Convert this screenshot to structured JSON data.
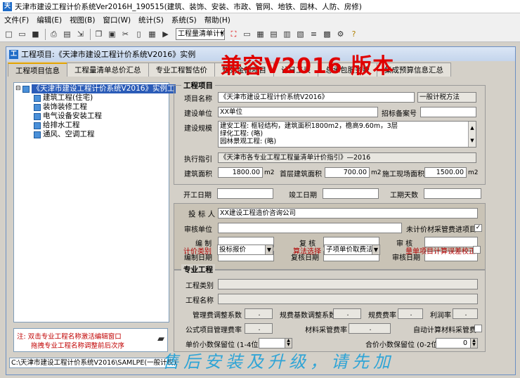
{
  "app": {
    "title": "天津市建设工程计价系统Ver2016H_190515(建筑、装饰、安装、市政、管网、地铁、园林、人防、房修)"
  },
  "menu": [
    "文件(F)",
    "编辑(E)",
    "视图(B)",
    "窗口(W)",
    "统计(S)",
    "系统(S)",
    "帮助(H)"
  ],
  "toolbar": {
    "select_value": "工程量清单计价"
  },
  "window": {
    "title": "工程项目:《天津市建设工程计价系统V2016》实例"
  },
  "watermark": {
    "top": "兼容V2016 版本",
    "bottom": "售后安装及升级，请先加"
  },
  "tabs": [
    "工程项目信息",
    "工程量清单总价汇总",
    "专业工程暂估价",
    "暂列金额项目",
    "计日工表",
    "总承包服务费",
    "集成预算信息汇总"
  ],
  "tree": {
    "root": "《天津市建设工程计价系统V2016》实例工",
    "items": [
      "建筑工程(住宅)",
      "装饰装修工程",
      "电气设备安装工程",
      "给排水工程",
      "通风、空调工程"
    ]
  },
  "note": {
    "line1": "注: 双击专业工程名称激活编辑窗口",
    "line2": "拖拽专业工程名称调整前后次序"
  },
  "status": {
    "path": "C:\\天津市建设工程计价系统V2016\\SAMLPE(一般计税)"
  },
  "project": {
    "group_title": "工程项目",
    "name_label": "项目名称",
    "name_value": "《天津市建设工程计价系统V2016》",
    "tax_method": "一般计税方法",
    "builder_label": "建设单位",
    "builder_value": "XX单位",
    "bid_no_label": "招标备案号",
    "bid_no_value": "",
    "scale_label": "建设规模",
    "scale_lines": [
      "建安工程: 框轻结构，建筑面积1800m2，檐高9.60m，3层",
      "绿化工程: (略)",
      "园林景观工程: (略)"
    ],
    "guide_label": "执行指引",
    "guide_value": "《天津市各专业工程工程量清单计价指引》—2016",
    "area_label": "建筑面积",
    "area_value": "1800.00",
    "area_unit": "m2",
    "first_area_label": "首层建筑面积",
    "first_area_value": "700.00",
    "first_area_unit": "m2",
    "site_area_label": "施工现场面积",
    "site_area_value": "1500.00",
    "site_area_unit": "m2",
    "start_label": "开工日期",
    "end_label": "竣工日期",
    "days_label": "工期天数"
  },
  "bid": {
    "bidder_label": "投 标 人",
    "bidder_value": "XX建设工程造价咨询公司",
    "review_unit_label": "审核单位",
    "unpriced_label": "未计价材采管费进项目",
    "unpriced_checked": "✓",
    "compile_label": "编 制",
    "recheck_label": "复 核",
    "audit_label": "审 核",
    "compile_date_label": "编制日期",
    "recheck_date_label": "复核日期",
    "audit_date_label": "审核日期",
    "price_type_label": "计价类别",
    "price_type_value": "投标报价",
    "algo_label": "算法选择",
    "algo_value": "子项单价取费法",
    "qty_check_label": "量单项目计算误差校正"
  },
  "specialty": {
    "group_title": "专业工程",
    "type_label": "工程类别",
    "name_label": "工程名称",
    "mgmt_label": "管理费调整系数",
    "mgmt_value": ".",
    "fee_base_label": "规费基数调整系数",
    "fee_base_value": ".",
    "fee_rate_label": "规费费率",
    "fee_rate_value": ".",
    "profit_label": "利润率",
    "profit_value": ".",
    "public_label": "公式项目管理费率",
    "public_value": ".",
    "mat_label": "材料采管费率",
    "mat_value": ".",
    "auto_label": "自动计算材料采管费",
    "unit_dec_label": "单价小数保留位 (1-4位)",
    "unit_dec_value": "",
    "total_dec_label": "合价小数保留位 (0-2位)",
    "total_dec_value": "0"
  }
}
